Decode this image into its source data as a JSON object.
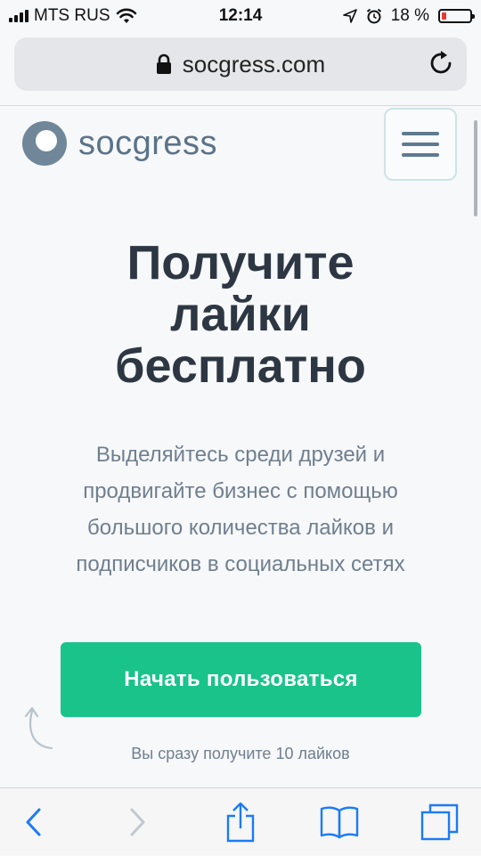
{
  "status_bar": {
    "carrier": "MTS RUS",
    "time": "12:14",
    "battery_percent": "18 %",
    "battery_level": 0.18,
    "signal_icon": "signal-bars-icon",
    "wifi_icon": "wifi-icon",
    "location_icon": "location-arrow-icon",
    "alarm_icon": "alarm-clock-icon"
  },
  "browser": {
    "url": "socgress.com",
    "lock_icon": "lock-icon",
    "reload_icon": "reload-icon"
  },
  "header": {
    "logo_text": "socgress",
    "menu_icon": "hamburger-menu-icon"
  },
  "hero": {
    "title_line1": "Получите",
    "title_line2": "лайки",
    "title_line3": "бесплатно",
    "desc_line1": "Выделяйтесь среди друзей и",
    "desc_line2": "продвигайте бизнес с помощью",
    "desc_line3": "большого количества лайков и",
    "desc_line4": "подписчиков в социальных сетях",
    "cta_label": "Начать пользоваться",
    "cta_note": "Вы сразу получите 10 лайков"
  },
  "toolbar": {
    "back_icon": "back-chevron-icon",
    "forward_icon": "forward-chevron-icon",
    "share_icon": "share-icon",
    "bookmarks_icon": "bookmarks-book-icon",
    "tabs_icon": "tabs-icon"
  },
  "colors": {
    "accent_green": "#19c38a",
    "ios_blue": "#1b7bf5",
    "title_dark": "#2d3743",
    "logo_slate": "#5b7389",
    "text_muted": "#6f7f8f"
  }
}
